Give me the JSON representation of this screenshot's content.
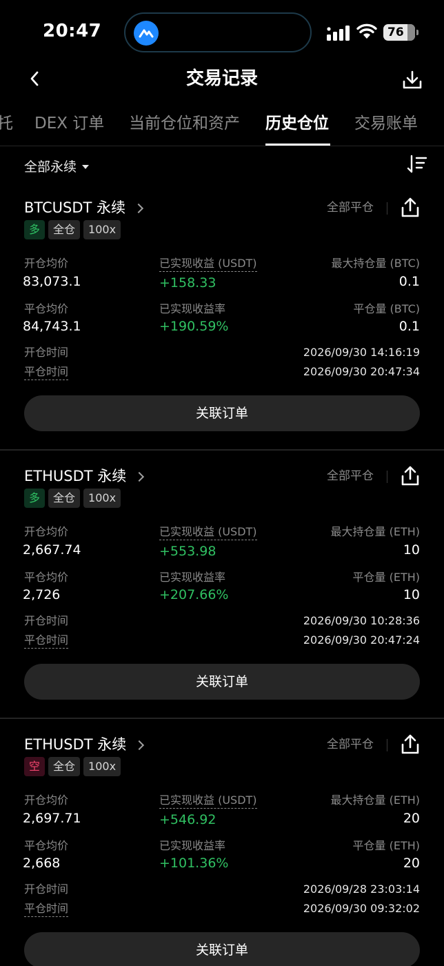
{
  "status": {
    "time": "20:47",
    "battery": "76"
  },
  "nav": {
    "title": "交易记录"
  },
  "tabs": [
    {
      "label": "托"
    },
    {
      "label": "DEX 订单"
    },
    {
      "label": "当前仓位和资产"
    },
    {
      "label": "历史仓位"
    },
    {
      "label": "交易账单"
    }
  ],
  "filter": {
    "label": "全部永续"
  },
  "labels": {
    "avg_open": "开仓均价",
    "avg_close": "平仓均价",
    "realized_pnl": "已实现收益 (USDT)",
    "realized_rate": "已实现收益率",
    "open_time": "开仓时间",
    "close_time": "平仓时间",
    "related_orders": "关联订单",
    "close_type": "全部平仓"
  },
  "positions": [
    {
      "symbol": "BTCUSDT 永续",
      "side": "多",
      "margin": "全仓",
      "leverage": "100x",
      "avg_open": "83,073.1",
      "avg_close": "84,743.1",
      "pnl": "+158.33",
      "pnl_rate": "+190.59%",
      "max_pos_label": "最大持仓量 (BTC)",
      "max_pos": "0.1",
      "closed_label": "平仓量 (BTC)",
      "closed": "0.1",
      "open_time": "2026/09/30 14:16:19",
      "close_time": "2026/09/30 20:47:34"
    },
    {
      "symbol": "ETHUSDT 永续",
      "side": "多",
      "margin": "全仓",
      "leverage": "100x",
      "avg_open": "2,667.74",
      "avg_close": "2,726",
      "pnl": "+553.98",
      "pnl_rate": "+207.66%",
      "max_pos_label": "最大持仓量 (ETH)",
      "max_pos": "10",
      "closed_label": "平仓量 (ETH)",
      "closed": "10",
      "open_time": "2026/09/30 10:28:36",
      "close_time": "2026/09/30 20:47:24"
    },
    {
      "symbol": "ETHUSDT 永续",
      "side": "空",
      "margin": "全仓",
      "leverage": "100x",
      "avg_open": "2,697.71",
      "avg_close": "2,668",
      "pnl": "+546.92",
      "pnl_rate": "+101.36%",
      "max_pos_label": "最大持仓量 (ETH)",
      "max_pos": "20",
      "closed_label": "平仓量 (ETH)",
      "closed": "20",
      "open_time": "2026/09/28 23:03:14",
      "close_time": "2026/09/30 09:32:02"
    }
  ],
  "colors": {
    "profit": "#30c062",
    "long": "#2fbf63",
    "short": "#f2456e",
    "background": "#000000"
  }
}
